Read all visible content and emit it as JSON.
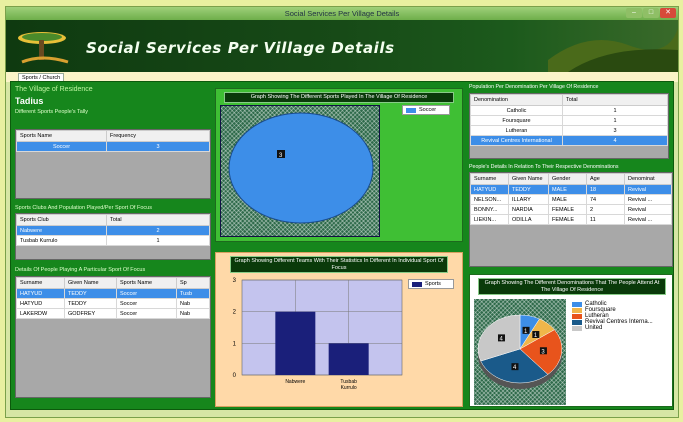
{
  "window": {
    "title": "Social Services Per Village Details"
  },
  "banner": {
    "title": "Social Services Per Village Details"
  },
  "tabs": [
    {
      "label": "Sports / Church"
    }
  ],
  "left": {
    "village_label": "The Village of Residence",
    "village_name": "Tadius",
    "sports_tally_label": "Different Sports  People's Tally",
    "sports_tally": {
      "headers": [
        "Sports Name",
        "Frequency"
      ],
      "rows": [
        [
          "Soccer",
          "3"
        ]
      ]
    },
    "clubs_label": "Sports Clubs And Population Played/Per Sport Of Focus",
    "clubs": {
      "headers": [
        "Sports Club",
        "Total"
      ],
      "rows": [
        [
          "Nabwere",
          "2"
        ],
        [
          "Tusbab Kurrulo",
          "1"
        ]
      ]
    },
    "people_label": "Details Of People Playing A Particular Sport Of Focus",
    "people": {
      "headers": [
        "Surname",
        "Given Name",
        "Sports Name",
        "Sp"
      ],
      "rows": [
        [
          "HATYUD",
          "TEDDY",
          "Soccer",
          "Tusb"
        ],
        [
          "HATYUD",
          "TEDDY",
          "Soccer",
          "Nab"
        ],
        [
          "LAKERDW",
          "GODFREY",
          "Soccer",
          "Nab"
        ]
      ]
    }
  },
  "chart_top": {
    "title": "Graph Showing The Different Sports Played In The Village Of Residence",
    "legend": "Soccer",
    "label": "3"
  },
  "chart_bottom": {
    "title": "Graph Showing Different Teams With Their Statistics In Different In Individual Sport Of Focus",
    "legend": "Sports"
  },
  "chart_right": {
    "title": "Graph Showing The Different Denominations That The People Attend At The Village Of Residence",
    "legend": [
      "Catholic",
      "Foursquare",
      "Lutheran",
      "Revival Centres Interna...",
      "United"
    ]
  },
  "right": {
    "denom_label": "Population Per Denomination Per Village Of Residence",
    "denom": {
      "headers": [
        "Denomination",
        "Total"
      ],
      "rows": [
        [
          "Catholic",
          "1"
        ],
        [
          "Foursquare",
          "1"
        ],
        [
          "Lutheran",
          "3"
        ],
        [
          "Revival Centres International",
          "4"
        ]
      ]
    },
    "people_label": "People's Details In Relation To Their Respective Denominations",
    "people": {
      "headers": [
        "Surname",
        "Given Name",
        "Gender",
        "Age",
        "Denominat"
      ],
      "rows": [
        [
          "HATYUD",
          "TEDDY",
          "MALE",
          "18",
          "Revival"
        ],
        [
          "NELSON...",
          "ILLARY",
          "MALE",
          "74",
          "Revival ..."
        ],
        [
          "BONNY...",
          "NARDIA",
          "FEMALE",
          "2",
          "Revival"
        ],
        [
          "LIEKIN...",
          "ODILLA",
          "FEMALE",
          "11",
          "Revival ..."
        ]
      ]
    }
  },
  "chart_data": [
    {
      "type": "pie",
      "title": "Graph Showing The Different Sports Played In The Village Of Residence",
      "categories": [
        "Soccer"
      ],
      "values": [
        3
      ],
      "colors": [
        "#3d8ee8"
      ]
    },
    {
      "type": "bar",
      "title": "Graph Showing Different Teams With Their Statistics In Different In Individual Sport Of Focus",
      "categories": [
        "Nabwere",
        "Tusbab Kurrulo"
      ],
      "series": [
        {
          "name": "Sports",
          "values": [
            2,
            1
          ]
        }
      ],
      "ylim": [
        0,
        3
      ],
      "yticks": [
        0,
        1,
        2,
        3
      ],
      "colors": [
        "#1a1f7a"
      ]
    },
    {
      "type": "pie",
      "title": "Graph Showing The Different Denominations That The People Attend At The Village Of Residence",
      "categories": [
        "Catholic",
        "Foursquare",
        "Lutheran",
        "Revival Centres Interna...",
        "United"
      ],
      "values": [
        1,
        1,
        3,
        4,
        4
      ],
      "colors": [
        "#3d8ee8",
        "#f0b64a",
        "#e8541c",
        "#1a5a8a",
        "#c8c8c8"
      ]
    }
  ]
}
